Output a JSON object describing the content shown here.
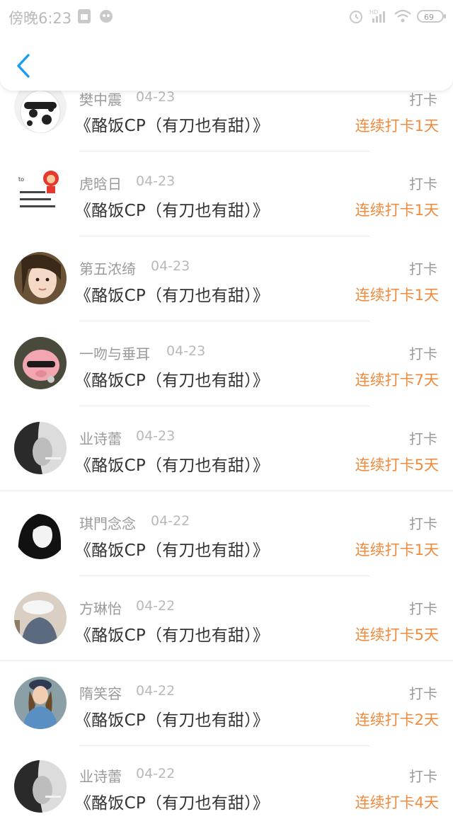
{
  "status_bar": {
    "time": "傍晚6:23",
    "battery": "69",
    "icons": [
      "sim-icon",
      "notification-icon",
      "alarm-icon",
      "hd-signal-icon",
      "wifi-icon",
      "battery-icon"
    ]
  },
  "header": {
    "back_icon": "chevron-left-icon"
  },
  "colors": {
    "streak": "#f08a3c",
    "back": "#1a9cf0"
  },
  "items": [
    {
      "name": "樊中震",
      "date": "04-23",
      "book": "《酪饭CP（有刀也有甜）》",
      "label": "打卡",
      "streak": "连续打卡1天"
    },
    {
      "name": "虎晗日",
      "date": "04-23",
      "book": "《酪饭CP（有刀也有甜）》",
      "label": "打卡",
      "streak": "连续打卡1天"
    },
    {
      "name": "第五浓绮",
      "date": "04-23",
      "book": "《酪饭CP（有刀也有甜）》",
      "label": "打卡",
      "streak": "连续打卡1天"
    },
    {
      "name": "一吻与垂耳",
      "date": "04-23",
      "book": "《酪饭CP（有刀也有甜）》",
      "label": "打卡",
      "streak": "连续打卡7天"
    },
    {
      "name": "业诗蕾",
      "date": "04-23",
      "book": "《酪饭CP（有刀也有甜）》",
      "label": "打卡",
      "streak": "连续打卡5天"
    },
    {
      "name": "琪門念念",
      "date": "04-22",
      "book": "《酪饭CP（有刀也有甜）》",
      "label": "打卡",
      "streak": "连续打卡1天"
    },
    {
      "name": "方琳怡",
      "date": "04-22",
      "book": "《酪饭CP（有刀也有甜）》",
      "label": "打卡",
      "streak": "连续打卡5天"
    },
    {
      "name": "隋笑容",
      "date": "04-22",
      "book": "《酪饭CP（有刀也有甜）》",
      "label": "打卡",
      "streak": "连续打卡2天"
    },
    {
      "name": "业诗蕾",
      "date": "04-22",
      "book": "《酪饭CP（有刀也有甜）》",
      "label": "打卡",
      "streak": "连续打卡4天"
    }
  ]
}
